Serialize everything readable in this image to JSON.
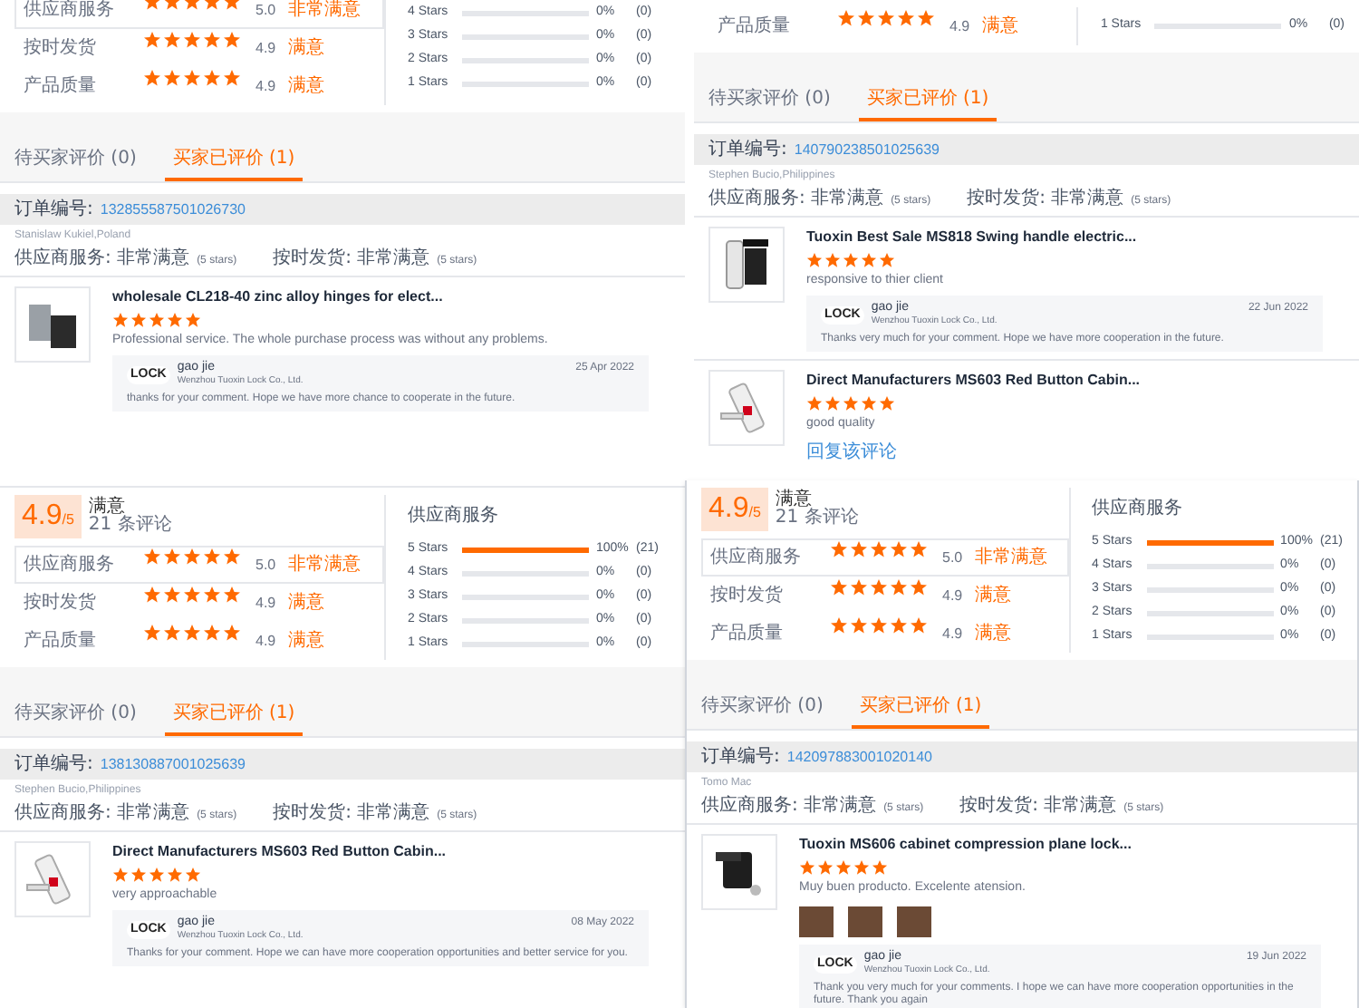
{
  "panels": [
    {
      "summary": {
        "criteria": [
          {
            "label": "供应商服务",
            "stars": 5,
            "value": "5.0",
            "verdict": "非常满意",
            "selected": true
          },
          {
            "label": "按时发货",
            "stars": 5,
            "value": "4.9",
            "verdict": "满意",
            "selected": false
          },
          {
            "label": "产品质量",
            "stars": 5,
            "value": "4.9",
            "verdict": "满意",
            "selected": false
          }
        ],
        "breakdown": [
          {
            "label": "4 Stars",
            "level": 0,
            "percent": "0%",
            "count": "(0)"
          },
          {
            "label": "3 Stars",
            "level": 0,
            "percent": "0%",
            "count": "(0)"
          },
          {
            "label": "2 Stars",
            "level": 0,
            "percent": "0%",
            "count": "(0)"
          },
          {
            "label": "1 Stars",
            "level": 0,
            "percent": "0%",
            "count": "(0)"
          }
        ]
      },
      "tabs": [
        {
          "label": "待买家评价 (0)",
          "selected": false
        },
        {
          "label": "买家已评价 (1)",
          "selected": true
        }
      ],
      "order": {
        "label": "订单编号:",
        "number": "132855587501026730"
      },
      "buyer": "Stanislaw Kukiel,Poland",
      "buyer_ratings": [
        {
          "text": "供应商服务: 非常满意",
          "note": "(5 stars)"
        },
        {
          "text": "按时发货: 非常满意",
          "note": "(5 stars)"
        }
      ],
      "reviews": [
        {
          "kind": "hinge",
          "title": "wholesale CL218-40 zinc alloy hinges for elect...",
          "stars": 5,
          "comment": "Professional service. The whole purchase process was without any problems.",
          "reply": {
            "logo": "LOCK",
            "name": "gao jie",
            "company": "Wenzhou Tuoxin Lock Co., Ltd.",
            "date": "25 Apr 2022",
            "text": "thanks for your comment. Hope we have more chance to cooperate in the future."
          }
        }
      ]
    },
    {
      "summary": {
        "criteria": [
          {
            "label": "产品质量",
            "stars": 5,
            "value": "4.9",
            "verdict": "满意",
            "selected": false
          }
        ],
        "breakdown": [
          {
            "label": "1 Stars",
            "level": 0,
            "percent": "0%",
            "count": "(0)"
          }
        ]
      },
      "tabs": [
        {
          "label": "待买家评价 (0)",
          "selected": false
        },
        {
          "label": "买家已评价 (1)",
          "selected": true
        }
      ],
      "order": {
        "label": "订单编号:",
        "number": "140790238501025639"
      },
      "buyer": "Stephen Bucio,Philippines",
      "buyer_ratings": [
        {
          "text": "供应商服务: 非常满意",
          "note": "(5 stars)"
        },
        {
          "text": "按时发货: 非常满意",
          "note": "(5 stars)"
        }
      ],
      "reviews": [
        {
          "kind": "swing",
          "title": "Tuoxin Best Sale MS818 Swing handle electric...",
          "stars": 5,
          "comment": "responsive to thier client",
          "reply": {
            "logo": "LOCK",
            "name": "gao jie",
            "company": "Wenzhou Tuoxin Lock Co., Ltd.",
            "date": "22 Jun 2022",
            "text": "Thanks very much for your comment. Hope we have more cooperation in the future."
          }
        },
        {
          "kind": "button",
          "title": "Direct Manufacturers MS603 Red Button Cabin...",
          "stars": 5,
          "comment": "good quality",
          "link": "回复该评论"
        }
      ]
    },
    {
      "summary": {
        "score": "4.9",
        "scale": "/5",
        "verdict": "满意",
        "count": "21 条评论",
        "breakdown_title": "供应商服务",
        "criteria": [
          {
            "label": "供应商服务",
            "stars": 5,
            "value": "5.0",
            "verdict": "非常满意",
            "selected": true
          },
          {
            "label": "按时发货",
            "stars": 5,
            "value": "4.9",
            "verdict": "满意",
            "selected": false
          },
          {
            "label": "产品质量",
            "stars": 5,
            "value": "4.9",
            "verdict": "满意",
            "selected": false
          }
        ],
        "breakdown": [
          {
            "label": "5 Stars",
            "level": 1,
            "percent": "100%",
            "count": "(21)"
          },
          {
            "label": "4 Stars",
            "level": 0,
            "percent": "0%",
            "count": "(0)"
          },
          {
            "label": "3 Stars",
            "level": 0,
            "percent": "0%",
            "count": "(0)"
          },
          {
            "label": "2 Stars",
            "level": 0,
            "percent": "0%",
            "count": "(0)"
          },
          {
            "label": "1 Stars",
            "level": 0,
            "percent": "0%",
            "count": "(0)"
          }
        ]
      },
      "tabs": [
        {
          "label": "待买家评价 (0)",
          "selected": false
        },
        {
          "label": "买家已评价 (1)",
          "selected": true
        }
      ],
      "order": {
        "label": "订单编号:",
        "number": "138130887001025639"
      },
      "buyer": "Stephen Bucio,Philippines",
      "buyer_ratings": [
        {
          "text": "供应商服务: 非常满意",
          "note": "(5 stars)"
        },
        {
          "text": "按时发货: 非常满意",
          "note": "(5 stars)"
        }
      ],
      "reviews": [
        {
          "kind": "button",
          "title": "Direct Manufacturers MS603 Red Button Cabin...",
          "stars": 5,
          "comment": "very approachable",
          "reply": {
            "logo": "LOCK",
            "name": "gao jie",
            "company": "Wenzhou Tuoxin Lock Co., Ltd.",
            "date": "08 May 2022",
            "text": "Thanks for your comment. Hope we can have more cooperation opportunities and better service for you."
          }
        }
      ]
    },
    {
      "summary": {
        "score": "4.9",
        "scale": "/5",
        "verdict": "满意",
        "count": "21 条评论",
        "breakdown_title": "供应商服务",
        "criteria": [
          {
            "label": "供应商服务",
            "stars": 5,
            "value": "5.0",
            "verdict": "非常满意",
            "selected": true
          },
          {
            "label": "按时发货",
            "stars": 5,
            "value": "4.9",
            "verdict": "满意",
            "selected": false
          },
          {
            "label": "产品质量",
            "stars": 5,
            "value": "4.9",
            "verdict": "满意",
            "selected": false
          }
        ],
        "breakdown": [
          {
            "label": "5 Stars",
            "level": 1,
            "percent": "100%",
            "count": "(21)"
          },
          {
            "label": "4 Stars",
            "level": 0,
            "percent": "0%",
            "count": "(0)"
          },
          {
            "label": "3 Stars",
            "level": 0,
            "percent": "0%",
            "count": "(0)"
          },
          {
            "label": "2 Stars",
            "level": 0,
            "percent": "0%",
            "count": "(0)"
          },
          {
            "label": "1 Stars",
            "level": 0,
            "percent": "0%",
            "count": "(0)"
          }
        ]
      },
      "tabs": [
        {
          "label": "待买家评价 (0)",
          "selected": false
        },
        {
          "label": "买家已评价 (1)",
          "selected": true
        }
      ],
      "order": {
        "label": "订单编号:",
        "number": "142097883001020140"
      },
      "buyer": "Tomo Mac",
      "buyer_ratings": [
        {
          "text": "供应商服务: 非常满意",
          "note": "(5 stars)"
        },
        {
          "text": "按时发货: 非常满意",
          "note": "(5 stars)"
        }
      ],
      "reviews": [
        {
          "kind": "lock",
          "title": "Tuoxin MS606 cabinet compression plane lock...",
          "stars": 5,
          "comment": "Muy buen producto. Excelente atension.",
          "photos": [
            {
              "kind": "photo"
            },
            {
              "kind": "photo"
            },
            {
              "kind": "photo"
            }
          ],
          "reply": {
            "logo": "LOCK",
            "name": "gao jie",
            "company": "Wenzhou Tuoxin Lock Co., Ltd.",
            "date": "19 Jun 2022",
            "text": "Thank you very much for your comments.  I hope we can have more cooperation opportunities in the future. Thank you again"
          }
        }
      ]
    }
  ]
}
